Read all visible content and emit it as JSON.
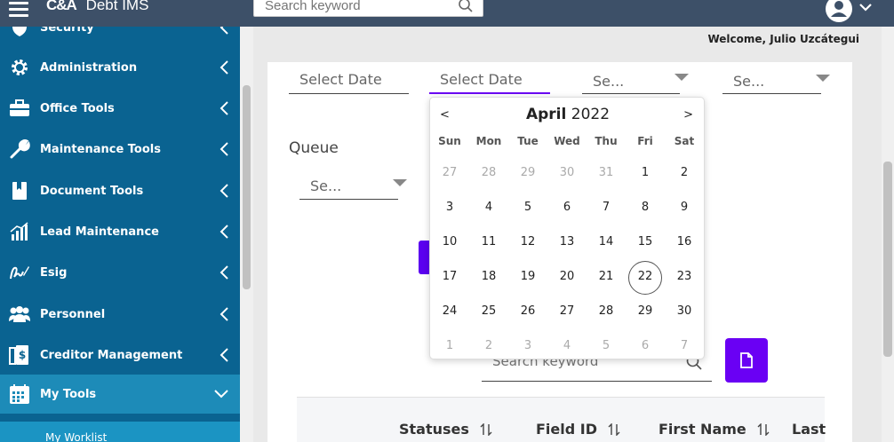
{
  "header": {
    "logo_text": "C&A",
    "product_name": "Debt IMS",
    "search_placeholder": "Search keyword"
  },
  "sidebar": {
    "items": [
      {
        "label": "Security",
        "icon": "shield-icon"
      },
      {
        "label": "Administration",
        "icon": "gear-icon"
      },
      {
        "label": "Office Tools",
        "icon": "briefcase-icon"
      },
      {
        "label": "Maintenance Tools",
        "icon": "wrench-icon"
      },
      {
        "label": "Document Tools",
        "icon": "book-icon"
      },
      {
        "label": "Lead Maintenance",
        "icon": "chart-icon"
      },
      {
        "label": "Esig",
        "icon": "signature-icon"
      },
      {
        "label": "Personnel",
        "icon": "people-icon"
      },
      {
        "label": "Creditor Management",
        "icon": "dollar-doc-icon"
      },
      {
        "label": "My Tools",
        "icon": "calendar-icon"
      }
    ],
    "sub_item": "My Worklist"
  },
  "welcome_text": "Welcome, Julio Uzcátegui",
  "filters": {
    "date1": "Select Date",
    "date2": "Select Date",
    "select1": "Se...",
    "select2": "Se...",
    "queue_label": "Queue",
    "queue_select": "Se..."
  },
  "calendar": {
    "prev": "<",
    "next": ">",
    "month": "April",
    "year": "2022",
    "weekdays": [
      "Sun",
      "Mon",
      "Tue",
      "Wed",
      "Thu",
      "Fri",
      "Sat"
    ],
    "weeks": [
      [
        "27",
        "28",
        "29",
        "30",
        "31",
        "1",
        "2"
      ],
      [
        "3",
        "4",
        "5",
        "6",
        "7",
        "8",
        "9"
      ],
      [
        "10",
        "11",
        "12",
        "13",
        "14",
        "15",
        "16"
      ],
      [
        "17",
        "18",
        "19",
        "20",
        "21",
        "22",
        "23"
      ],
      [
        "24",
        "25",
        "26",
        "27",
        "28",
        "29",
        "30"
      ],
      [
        "1",
        "2",
        "3",
        "4",
        "5",
        "6",
        "7"
      ]
    ],
    "muted": [
      [
        0,
        0
      ],
      [
        0,
        1
      ],
      [
        0,
        2
      ],
      [
        0,
        3
      ],
      [
        0,
        4
      ],
      [
        5,
        0
      ],
      [
        5,
        1
      ],
      [
        5,
        2
      ],
      [
        5,
        3
      ],
      [
        5,
        4
      ],
      [
        5,
        5
      ],
      [
        5,
        6
      ]
    ],
    "today": [
      3,
      5
    ]
  },
  "list_search_placeholder": "Search keyword",
  "table": {
    "columns": [
      "Statuses",
      "Field ID",
      "First Name",
      "Last"
    ]
  },
  "colors": {
    "topbar": "#3d5068",
    "sidebar": "#0a6391",
    "accent": "#6a00f4"
  }
}
